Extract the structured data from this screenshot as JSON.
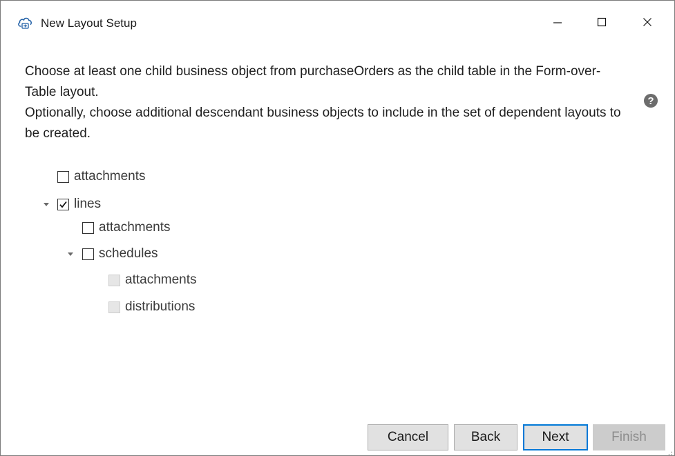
{
  "window": {
    "title": "New Layout Setup",
    "icon": "cloud-link-icon"
  },
  "instructions": {
    "line1": "Choose at least one child business object from purchaseOrders as the child table in the Form-over-Table layout.",
    "line2": "Optionally, choose additional descendant business objects to include in the set of dependent layouts to be created."
  },
  "help_icon": "question-circle-icon",
  "tree": {
    "items": [
      {
        "label": "attachments",
        "checked": false,
        "enabled": true,
        "expanded": null
      },
      {
        "label": "lines",
        "checked": true,
        "enabled": true,
        "expanded": true
      },
      {
        "label": "attachments",
        "checked": false,
        "enabled": true,
        "expanded": null
      },
      {
        "label": "schedules",
        "checked": false,
        "enabled": true,
        "expanded": true
      },
      {
        "label": "attachments",
        "checked": false,
        "enabled": false,
        "expanded": null
      },
      {
        "label": "distributions",
        "checked": false,
        "enabled": false,
        "expanded": null
      }
    ]
  },
  "footer": {
    "cancel_label": "Cancel",
    "back_label": "Back",
    "next_label": "Next",
    "finish_label": "Finish"
  },
  "colors": {
    "accent": "#0078d7",
    "disabled_bg": "#cccccc",
    "disabled_text": "#8c8c8c"
  }
}
